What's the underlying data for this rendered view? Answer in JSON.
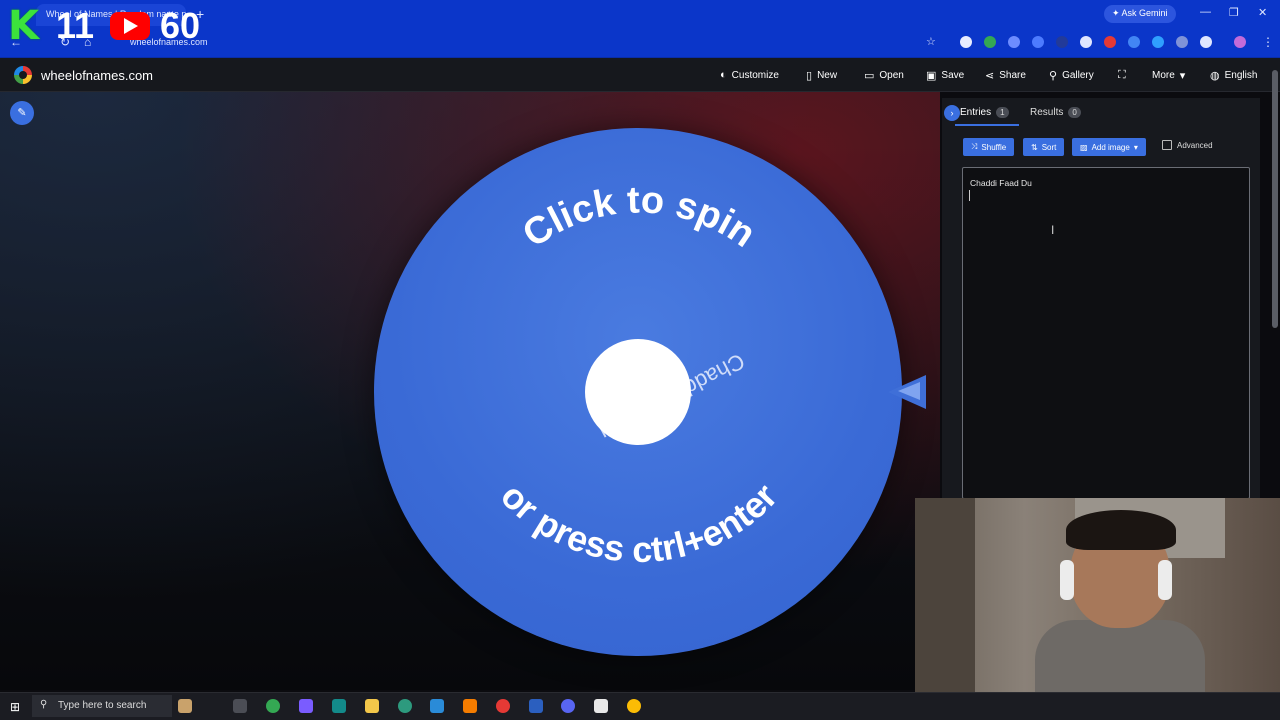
{
  "browser": {
    "tab_title": "Wheel of Names | Random name picker",
    "tab_close": "×",
    "new_tab": "+",
    "ask_gemini": "Ask Gemini",
    "url": "wheelofnames.com",
    "window_controls": [
      "—",
      "❐",
      "✕"
    ]
  },
  "overlay": {
    "k": "K",
    "eleven": "11",
    "sixty": "60"
  },
  "app": {
    "site_name": "wheelofnames.com",
    "menu": [
      {
        "label": "Customize",
        "icon": "palette-icon"
      },
      {
        "label": "New",
        "icon": "file-icon"
      },
      {
        "label": "Open",
        "icon": "folder-icon"
      },
      {
        "label": "Save",
        "icon": "save-icon"
      },
      {
        "label": "Share",
        "icon": "share-icon"
      },
      {
        "label": "Gallery",
        "icon": "search-icon"
      },
      {
        "label": "",
        "icon": "fullscreen-icon"
      },
      {
        "label": "More",
        "icon": "chevron-down-icon"
      },
      {
        "label": "English",
        "icon": "globe-icon"
      }
    ]
  },
  "wheel": {
    "top_text": "Click to spin",
    "bottom_text": "or press ctrl+enter",
    "entry_label": "Chaddi Faad Du",
    "color": "#3a6ad6"
  },
  "panel": {
    "tabs": {
      "entries_label": "Entries",
      "entries_count": "1",
      "results_label": "Results",
      "results_count": "0"
    },
    "buttons": {
      "shuffle": "Shuffle",
      "sort": "Sort",
      "add_image": "Add image",
      "advanced": "Advanced"
    },
    "entries_text": "Chaddi Faad Du"
  },
  "taskbar": {
    "search_placeholder": "Type here to search"
  },
  "colors": {
    "accent": "#3a6fe0",
    "browser_blue": "#0b36c9"
  }
}
